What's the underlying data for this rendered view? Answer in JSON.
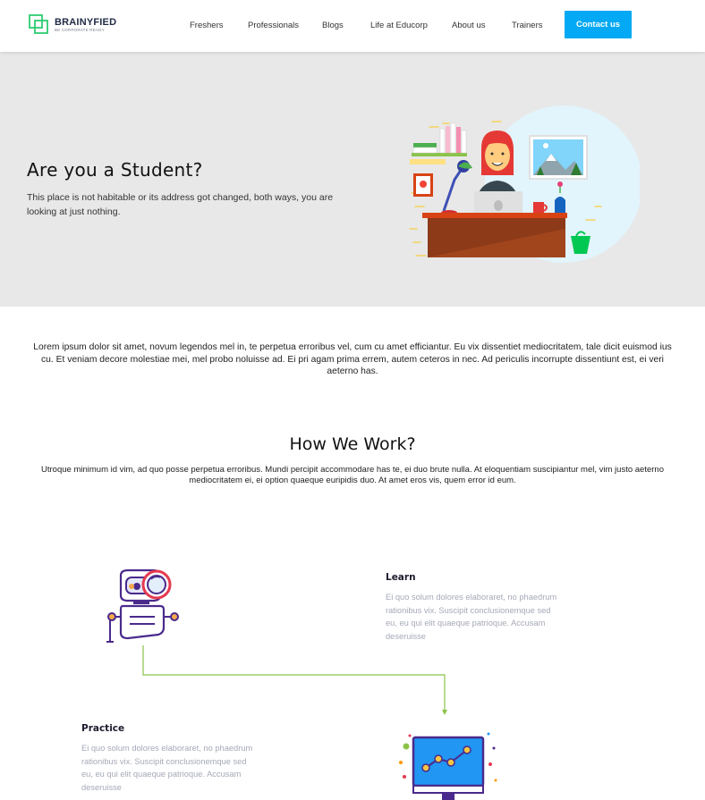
{
  "header": {
    "logo": {
      "name": "BRAINYFIED",
      "tagline": "BE CORPORATE READY"
    },
    "nav": [
      {
        "label": "Freshers"
      },
      {
        "label": "Professionals"
      },
      {
        "label": "Blogs"
      },
      {
        "label": "Life at Educorp"
      },
      {
        "label": "About us"
      },
      {
        "label": "Trainers"
      }
    ],
    "contact_label": "Contact us"
  },
  "hero": {
    "title": "Are you a Student?",
    "text": "This place is not habitable or its address got changed, both ways, you are looking at just nothing."
  },
  "intro": {
    "text": "Lorem ipsum dolor sit amet, novum legendos mel in, te perpetua erroribus vel, cum cu amet efficiantur. Eu vix dissentiet mediocritatem, tale dicit euismod ius cu. Et veniam decore molestiae mei, mel probo noluisse ad. Ei pri agam prima errem, autem ceteros in nec. Ad periculis incorrupte dissentiunt est, ei veri aeterno has."
  },
  "how": {
    "title": "How We Work?",
    "text": "Utroque minimum id vim, ad quo posse perpetua erroribus. Mundi percipit accommodare has te, ei duo brute nulla. At eloquentiam suscipiantur mel, vim justo aeterno mediocritatem ei, ei option quaeque euripidis duo. At amet eros vis, quem error id eum.",
    "steps": [
      {
        "title": "Learn",
        "text": "Ei quo solum dolores elaboraret, no phaedrum rationibus vix. Suscipit conclusionemque sed eu, eu qui elit quaeque patrioque. Accusam deseruisse"
      },
      {
        "title": "Practice",
        "text": "Ei quo solum dolores elaboraret, no phaedrum rationibus vix. Suscipit conclusionemque sed eu, eu qui elit quaeque patrioque. Accusam deseruisse"
      }
    ]
  },
  "colors": {
    "accent": "#03a9f4",
    "logo_green": "#2ecc71",
    "hero_bg": "#e8e8e8",
    "connector": "#8bc34a",
    "icon_purple": "#4a2a8c"
  },
  "icons": [
    "logo-squares-icon",
    "student-desk-illustration",
    "robot-magnifier-icon",
    "monitor-chart-icon"
  ]
}
